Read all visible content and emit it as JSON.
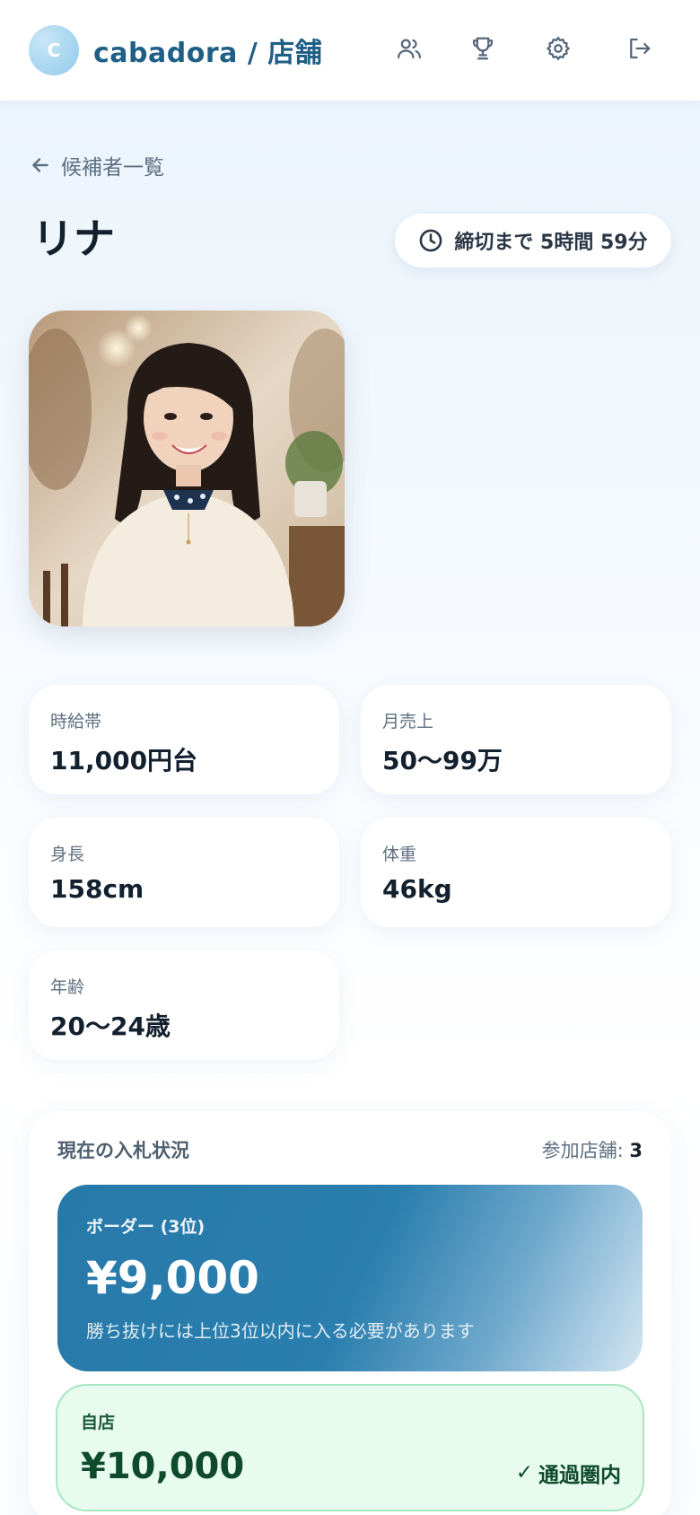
{
  "header": {
    "logo_letter": "C",
    "brand": "cabadora / 店舗",
    "icons": [
      "users-icon",
      "trophy-icon",
      "gear-icon",
      "logout-icon"
    ]
  },
  "nav": {
    "back_label": "候補者一覧"
  },
  "candidate": {
    "name": "リナ",
    "deadline": "締切まで 5時間 59分"
  },
  "stats": [
    {
      "label": "時給帯",
      "value": "11,000円台"
    },
    {
      "label": "月売上",
      "value": "50〜99万"
    },
    {
      "label": "身長",
      "value": "158cm"
    },
    {
      "label": "体重",
      "value": "46kg"
    },
    {
      "label": "年齢",
      "value": "20〜24歳"
    }
  ],
  "bids": {
    "title": "現在の入札状況",
    "participants_label": "参加店舗:",
    "participants_value": "3",
    "border": {
      "label": "ボーダー (3位)",
      "amount": "¥9,000",
      "note": "勝ち抜けには上位3位以内に入る必要があります"
    },
    "own": {
      "label": "自店",
      "amount": "¥10,000",
      "status": "通過圏内"
    }
  },
  "colors": {
    "brand": "#1f5f86",
    "accent_blue": "#2679a8",
    "success_bg": "#e7fbee",
    "success_text": "#0f4a2c"
  }
}
